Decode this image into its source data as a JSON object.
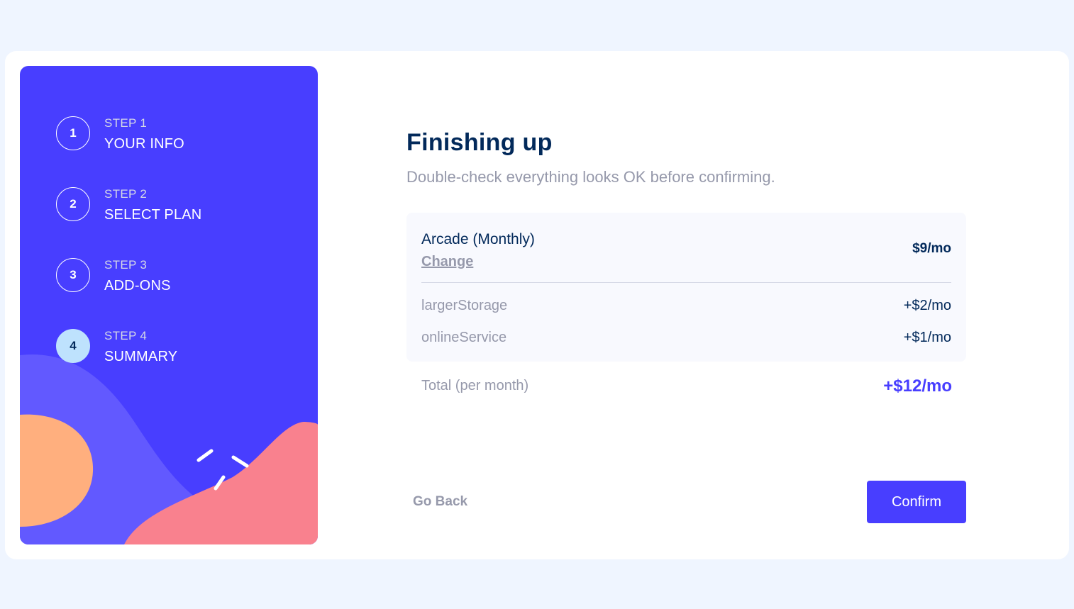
{
  "sidebar": {
    "steps": [
      {
        "number": "1",
        "label": "STEP 1",
        "title": "YOUR INFO",
        "active": false
      },
      {
        "number": "2",
        "label": "STEP 2",
        "title": "SELECT PLAN",
        "active": false
      },
      {
        "number": "3",
        "label": "STEP 3",
        "title": "ADD-ONS",
        "active": false
      },
      {
        "number": "4",
        "label": "STEP 4",
        "title": "SUMMARY",
        "active": true
      }
    ]
  },
  "main": {
    "title": "Finishing up",
    "subtitle": "Double-check everything looks OK before confirming.",
    "plan": {
      "name": "Arcade (Monthly)",
      "change_label": "Change",
      "price": "$9/mo"
    },
    "addons": [
      {
        "name": "largerStorage",
        "price": "+$2/mo"
      },
      {
        "name": "onlineService",
        "price": "+$1/mo"
      }
    ],
    "total": {
      "label": "Total (per month)",
      "price": "+$12/mo"
    },
    "buttons": {
      "back_label": "Go Back",
      "confirm_label": "Confirm"
    }
  },
  "colors": {
    "page_bg": "#eff5ff",
    "sidebar_bg": "#483eff",
    "accent": "#483eff",
    "denim": "#02295a",
    "active_step": "#bee2fd",
    "cool_gray": "#9699ab",
    "blob_orange": "#ffaf7e",
    "blob_pink": "#f9818e",
    "blob_purple": "#6259ff"
  }
}
